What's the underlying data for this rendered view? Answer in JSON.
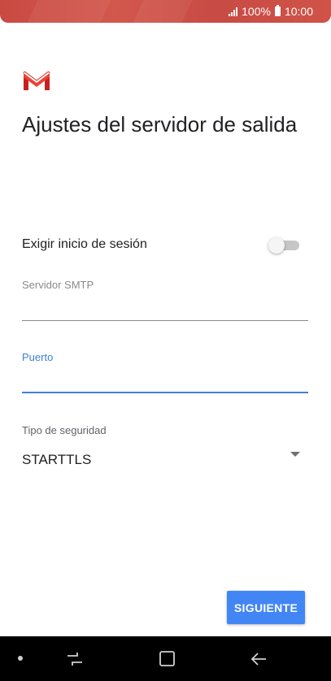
{
  "status_bar": {
    "battery_percent": "100%",
    "time": "10:00",
    "signal_icon": "signal-icon",
    "battery_icon": "battery-icon",
    "color": "#c94a42"
  },
  "app": {
    "logo_icon": "gmail-icon",
    "title": "Ajustes del servidor de salida"
  },
  "form": {
    "login_required": {
      "label": "Exigir inicio de sesión",
      "enabled": false
    },
    "smtp_server": {
      "label": "Servidor SMTP",
      "value": ""
    },
    "port": {
      "label": "Puerto",
      "value": "",
      "focused": true
    },
    "security_type": {
      "label": "Tipo de seguridad",
      "value": "STARTTLS"
    }
  },
  "actions": {
    "next_label": "SIGUIENTE"
  },
  "colors": {
    "accent": "#4285f4",
    "focus": "#3f80d8",
    "gmail_red": "#d94235"
  },
  "nav_bar": {
    "recents_icon": "recents-icon",
    "home_icon": "home-icon",
    "back_icon": "back-icon"
  }
}
